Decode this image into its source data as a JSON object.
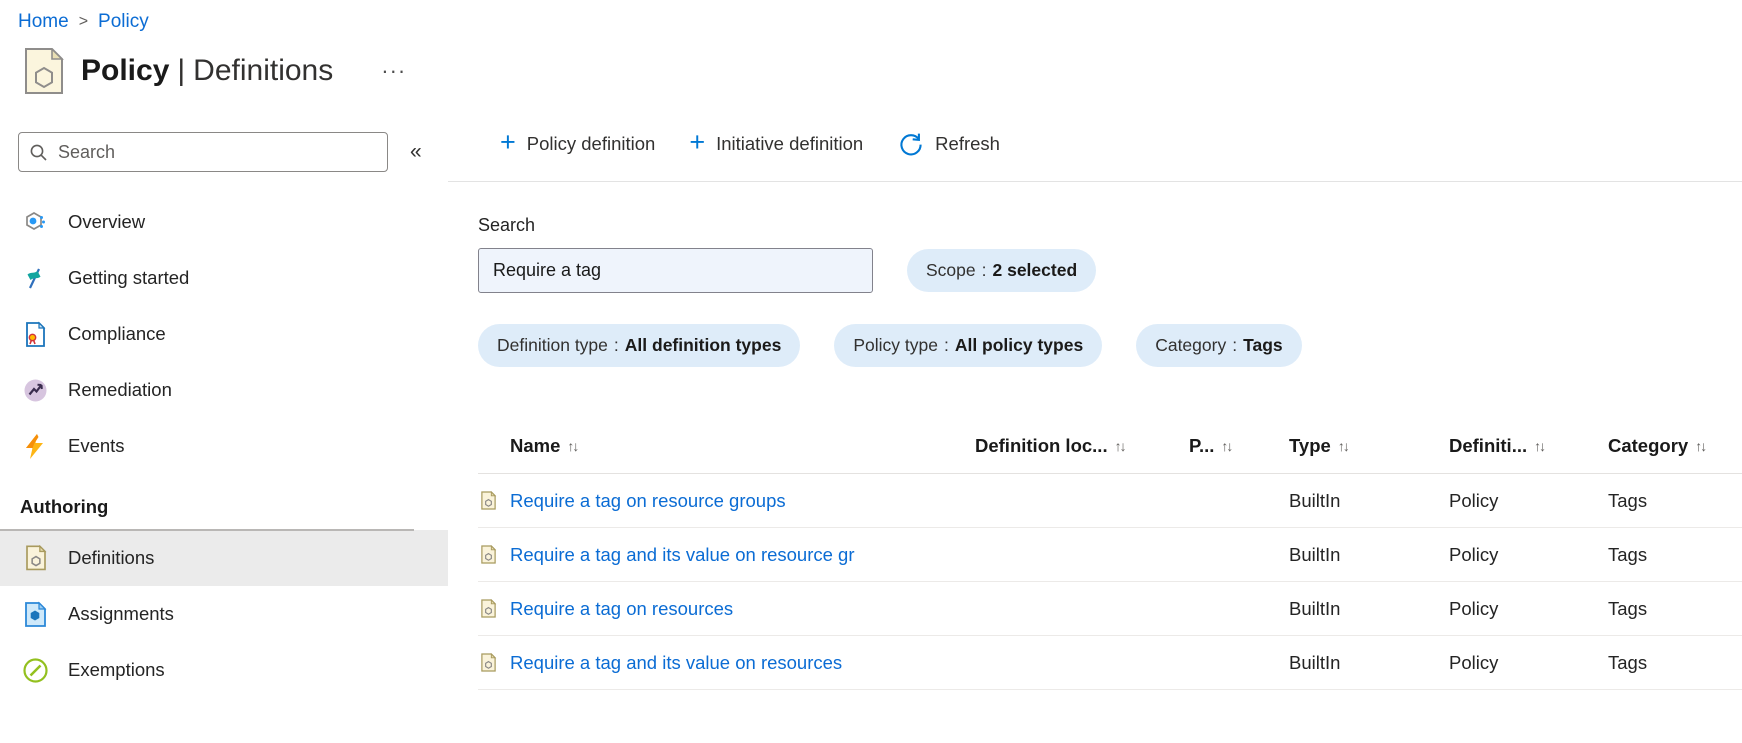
{
  "colors": {
    "accent": "#0078d4",
    "link": "#0b6cd4",
    "pill_bg": "#deecf9",
    "selected_item_bg": "#ebebeb",
    "search_input_bg": "#eff4fc"
  },
  "icons": {
    "sort": "↑↓",
    "collapse": "«",
    "breadcrumb_separator": ">",
    "more": "···",
    "plus": "+"
  },
  "breadcrumb": {
    "home": "Home",
    "policy": "Policy"
  },
  "header": {
    "title_primary": "Policy",
    "title_separator": "|",
    "title_secondary": "Definitions"
  },
  "sidebar": {
    "search_placeholder": "Search",
    "section_label": "Authoring",
    "items": [
      {
        "label": "Overview",
        "icon": "overview-icon",
        "selected": false
      },
      {
        "label": "Getting started",
        "icon": "getting-started-icon",
        "selected": false
      },
      {
        "label": "Compliance",
        "icon": "compliance-icon",
        "selected": false
      },
      {
        "label": "Remediation",
        "icon": "remediation-icon",
        "selected": false
      },
      {
        "label": "Events",
        "icon": "events-icon",
        "selected": false
      },
      {
        "label": "Definitions",
        "icon": "definitions-icon",
        "selected": true
      },
      {
        "label": "Assignments",
        "icon": "assignments-icon",
        "selected": false
      },
      {
        "label": "Exemptions",
        "icon": "exemptions-icon",
        "selected": false
      }
    ]
  },
  "toolbar": {
    "policy_definition": "Policy definition",
    "initiative_definition": "Initiative definition",
    "refresh": "Refresh"
  },
  "filters": {
    "search_label": "Search",
    "search_value": "Require a tag",
    "separator": ":",
    "scope": {
      "label": "Scope",
      "value": "2 selected"
    },
    "definition_type": {
      "label": "Definition type",
      "value": "All definition types"
    },
    "policy_type": {
      "label": "Policy type",
      "value": "All policy types"
    },
    "category": {
      "label": "Category",
      "value": "Tags"
    }
  },
  "table": {
    "columns": [
      {
        "label": "Name"
      },
      {
        "label": "Definition loc..."
      },
      {
        "label": "P..."
      },
      {
        "label": "Type"
      },
      {
        "label": "Definiti..."
      },
      {
        "label": "Category"
      }
    ],
    "rows": [
      {
        "name": "Require a tag on resource groups",
        "definition_location": "",
        "policies": "",
        "type": "BuiltIn",
        "definition_type": "Policy",
        "category": "Tags"
      },
      {
        "name": "Require a tag and its value on resource gr",
        "definition_location": "",
        "policies": "",
        "type": "BuiltIn",
        "definition_type": "Policy",
        "category": "Tags"
      },
      {
        "name": "Require a tag on resources",
        "definition_location": "",
        "policies": "",
        "type": "BuiltIn",
        "definition_type": "Policy",
        "category": "Tags"
      },
      {
        "name": "Require a tag and its value on resources",
        "definition_location": "",
        "policies": "",
        "type": "BuiltIn",
        "definition_type": "Policy",
        "category": "Tags"
      }
    ]
  }
}
